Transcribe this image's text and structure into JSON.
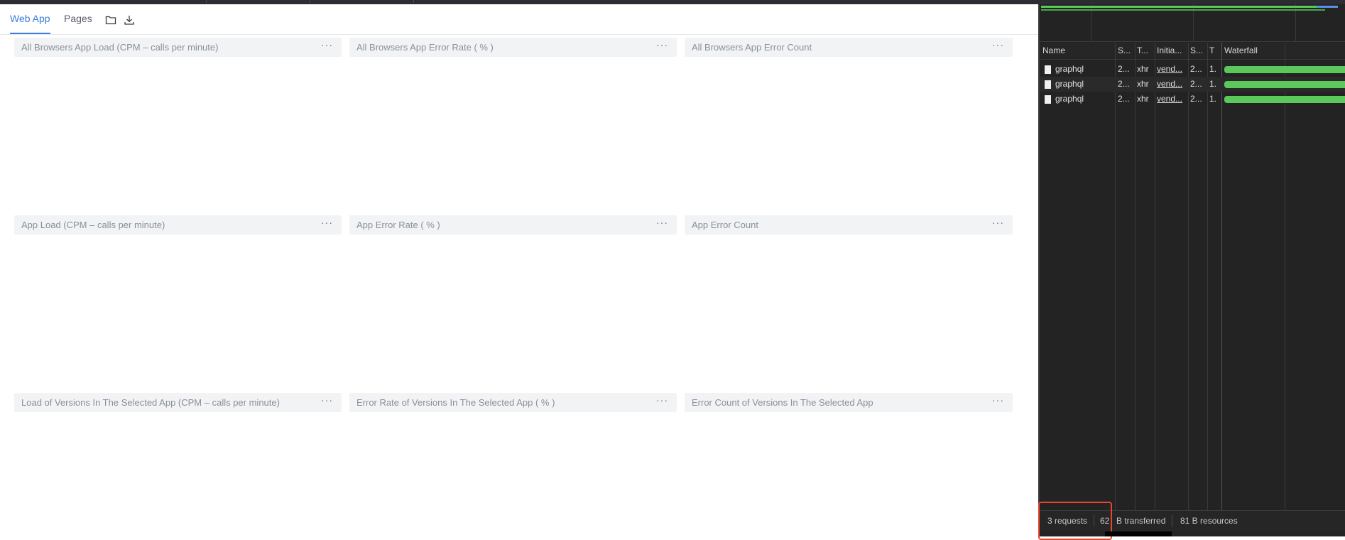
{
  "tabs": [
    {
      "label": "Web App",
      "active": true
    },
    {
      "label": "Pages",
      "active": false
    }
  ],
  "toolbar": {
    "folder_icon": "folder-icon",
    "download_icon": "download-icon"
  },
  "panels": {
    "row1": [
      {
        "title": "All Browsers App Load (CPM – calls per minute)",
        "more": "···"
      },
      {
        "title": "All Browsers App Error Rate ( % )",
        "more": "···"
      },
      {
        "title": "All Browsers App Error Count",
        "more": "···"
      }
    ],
    "row2": [
      {
        "title": "App Load (CPM – calls per minute)",
        "more": "···"
      },
      {
        "title": "App Error Rate ( % )",
        "more": "···"
      },
      {
        "title": "App Error Count",
        "more": "···"
      }
    ],
    "row3": [
      {
        "title": "Load of Versions In The Selected App (CPM – calls per minute)",
        "more": "···"
      },
      {
        "title": "Error Rate of Versions In The Selected App ( % )",
        "more": "···"
      },
      {
        "title": "Error Count of Versions In The Selected App",
        "more": "···"
      }
    ]
  },
  "devtools": {
    "columns": [
      "Name",
      "S...",
      "T...",
      "Initia...",
      "S...",
      "T",
      "Waterfall"
    ],
    "rows": [
      {
        "name": "graphql",
        "status": "2...",
        "type": "xhr",
        "initiator": "vend...",
        "size": "2...",
        "time": "1."
      },
      {
        "name": "graphql",
        "status": "2...",
        "type": "xhr",
        "initiator": "vend...",
        "size": "2...",
        "time": "1."
      },
      {
        "name": "graphql",
        "status": "2...",
        "type": "xhr",
        "initiator": "vend...",
        "size": "2...",
        "time": "1."
      }
    ],
    "status": {
      "requests": "3 requests",
      "transferred_value": "62",
      "transferred_label": "B transferred",
      "resources": "81 B resources"
    },
    "colors": {
      "waterfall_bar": "#5cc85c",
      "highlight_border": "#e8452c"
    }
  }
}
